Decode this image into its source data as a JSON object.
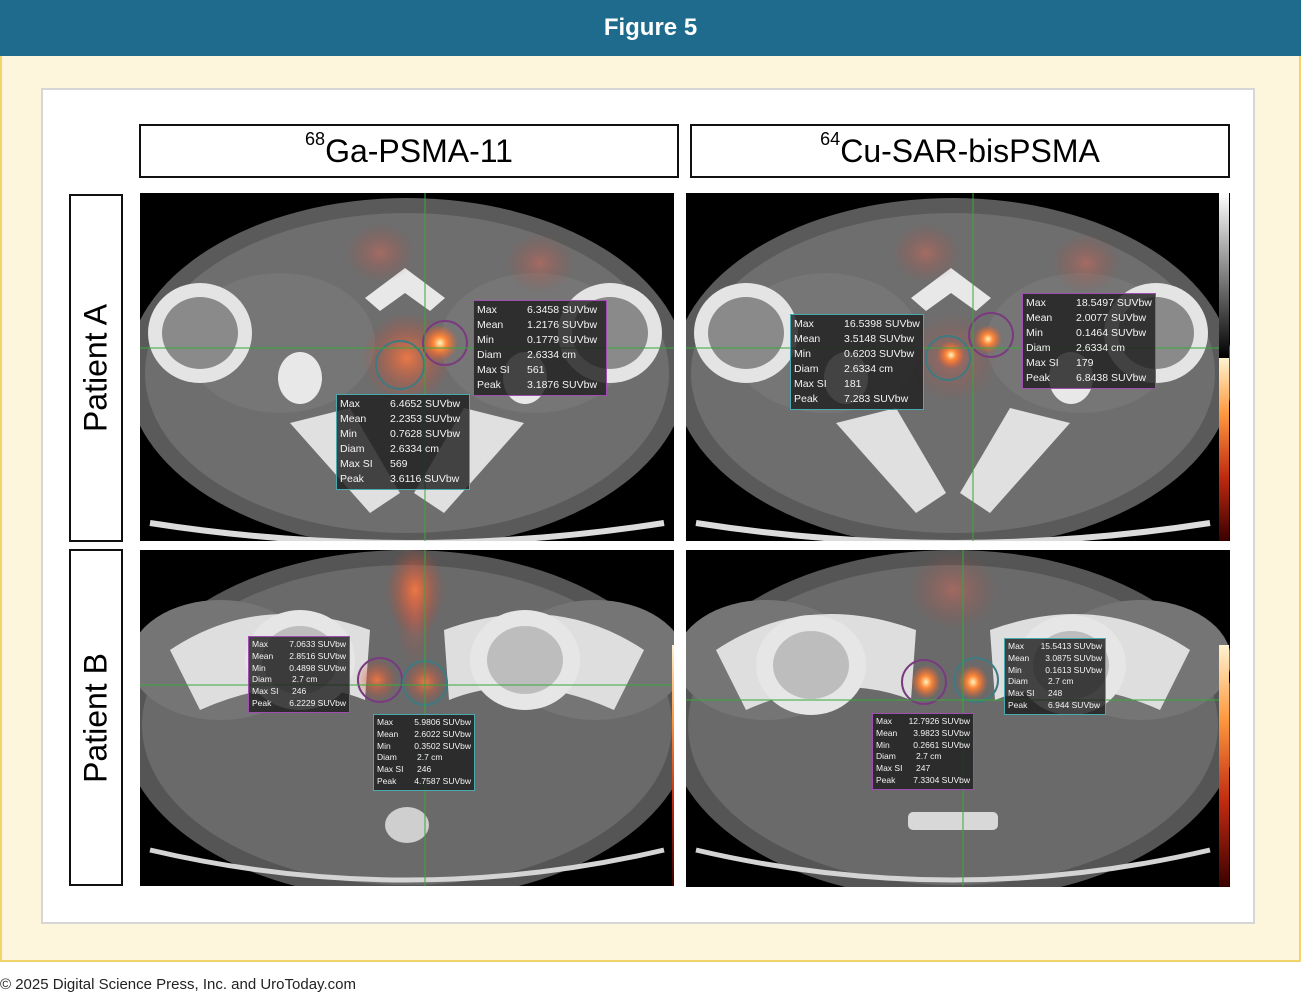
{
  "figure_title": "Figure 5",
  "columns": [
    {
      "sup": "68",
      "label": "Ga-PSMA-11"
    },
    {
      "sup": "64",
      "label": "Cu-SAR-bisPSMA"
    }
  ],
  "rows": [
    "Patient A",
    "Patient B"
  ],
  "roi_boxes": {
    "a_ga_right": [
      {
        "k": "Max",
        "v": "6.3458  SUVbw"
      },
      {
        "k": "Mean",
        "v": "1.2176  SUVbw"
      },
      {
        "k": "Min",
        "v": "0.1779  SUVbw"
      },
      {
        "k": "Diam",
        "v": "2.6334  cm"
      },
      {
        "k": "Max SI",
        "v": "561"
      },
      {
        "k": "Peak",
        "v": "3.1876  SUVbw"
      }
    ],
    "a_ga_left": [
      {
        "k": "Max",
        "v": "6.4652  SUVbw"
      },
      {
        "k": "Mean",
        "v": "2.2353  SUVbw"
      },
      {
        "k": "Min",
        "v": "0.7628  SUVbw"
      },
      {
        "k": "Diam",
        "v": "2.6334  cm"
      },
      {
        "k": "Max SI",
        "v": "569"
      },
      {
        "k": "Peak",
        "v": "3.6116  SUVbw"
      }
    ],
    "a_cu_left": [
      {
        "k": "Max",
        "v": "16.5398  SUVbw"
      },
      {
        "k": "Mean",
        "v": "3.5148  SUVbw"
      },
      {
        "k": "Min",
        "v": "0.6203  SUVbw"
      },
      {
        "k": "Diam",
        "v": "2.6334  cm"
      },
      {
        "k": "Max SI",
        "v": "181"
      },
      {
        "k": "Peak",
        "v": "7.283    SUVbw"
      }
    ],
    "a_cu_right": [
      {
        "k": "Max",
        "v": "18.5497  SUVbw"
      },
      {
        "k": "Mean",
        "v": "2.0077  SUVbw"
      },
      {
        "k": "Min",
        "v": "0.1464  SUVbw"
      },
      {
        "k": "Diam",
        "v": "2.6334  cm"
      },
      {
        "k": "Max SI",
        "v": "179"
      },
      {
        "k": "Peak",
        "v": "6.8438  SUVbw"
      }
    ],
    "b_ga_left": [
      {
        "k": "Max",
        "v": "7.0633  SUVbw"
      },
      {
        "k": "Mean",
        "v": "2.8516  SUVbw"
      },
      {
        "k": "Min",
        "v": "0.4898  SUVbw"
      },
      {
        "k": "Diam",
        "v": "2.7      cm"
      },
      {
        "k": "Max SI",
        "v": "246"
      },
      {
        "k": "Peak",
        "v": "6.2229  SUVbw"
      }
    ],
    "b_ga_right": [
      {
        "k": "Max",
        "v": "5.9806  SUVbw"
      },
      {
        "k": "Mean",
        "v": "2.6022  SUVbw"
      },
      {
        "k": "Min",
        "v": "0.3502  SUVbw"
      },
      {
        "k": "Diam",
        "v": "2.7      cm"
      },
      {
        "k": "Max SI",
        "v": "246"
      },
      {
        "k": "Peak",
        "v": "4.7587  SUVbw"
      }
    ],
    "b_cu_right": [
      {
        "k": "Max",
        "v": "15.5413  SUVbw"
      },
      {
        "k": "Mean",
        "v": "3.0875  SUVbw"
      },
      {
        "k": "Min",
        "v": "0.1613  SUVbw"
      },
      {
        "k": "Diam",
        "v": "2.7      cm"
      },
      {
        "k": "Max SI",
        "v": "248"
      },
      {
        "k": "Peak",
        "v": "6.944    SUVbw"
      }
    ],
    "b_cu_left": [
      {
        "k": "Max",
        "v": "12.7926  SUVbw"
      },
      {
        "k": "Mean",
        "v": "3.9823  SUVbw"
      },
      {
        "k": "Min",
        "v": "0.2661  SUVbw"
      },
      {
        "k": "Diam",
        "v": "2.7      cm"
      },
      {
        "k": "Max SI",
        "v": "247"
      },
      {
        "k": "Peak",
        "v": "7.3304  SUVbw"
      }
    ]
  },
  "colors": {
    "header_bg": "#1f6b8e",
    "frame_border": "#f3d36b",
    "roi_purple": "#a14cb0",
    "roi_teal": "#4aa8b0",
    "crosshair": "#3aa63a",
    "uptake": "#ff6a30"
  },
  "footer": "© 2025 Digital Science Press, Inc. and UroToday.com"
}
